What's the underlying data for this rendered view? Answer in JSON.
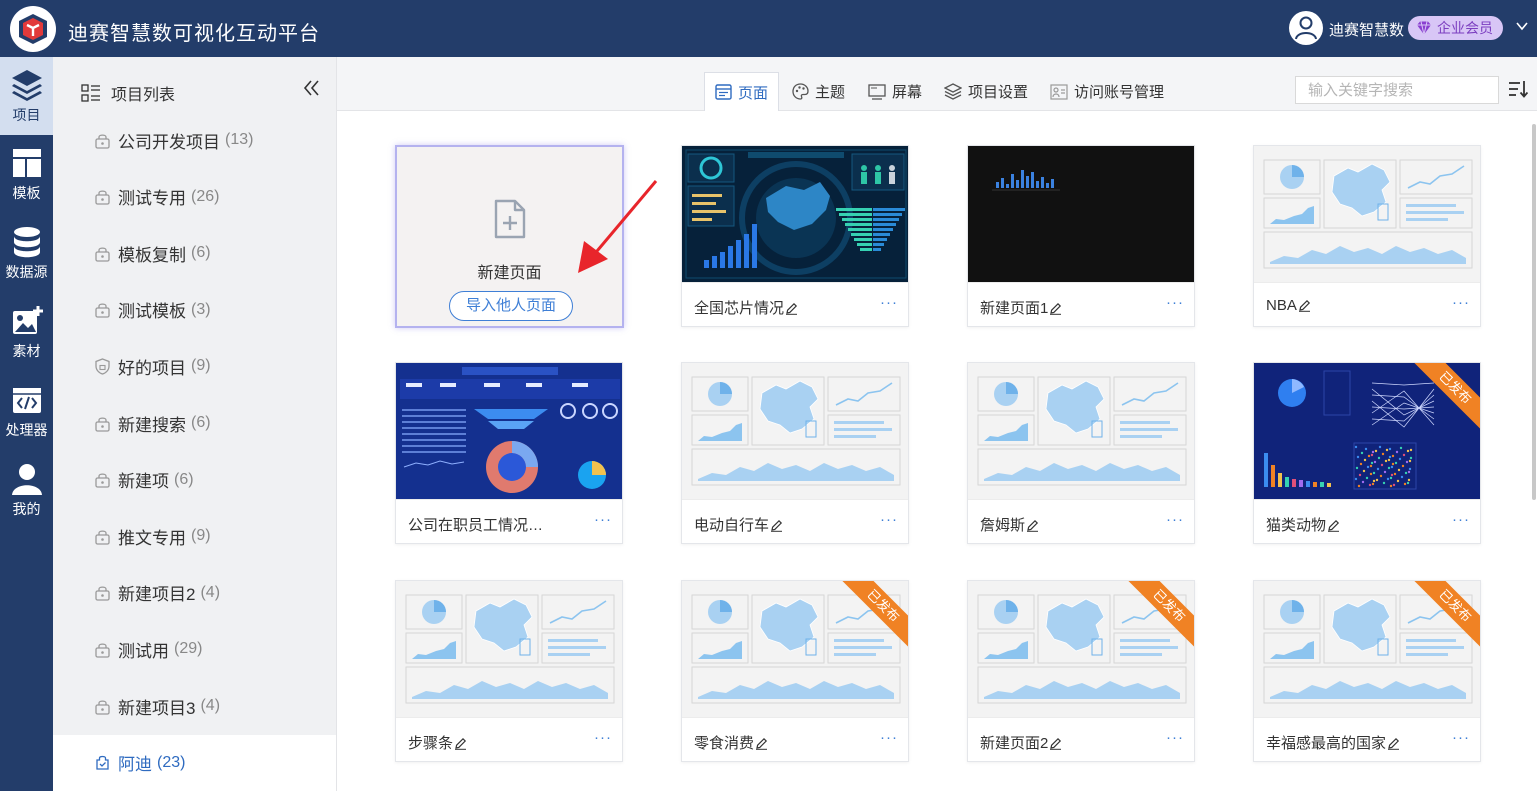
{
  "app": {
    "title": "迪赛智慧数可视化互动平台"
  },
  "user": {
    "name": "迪赛智慧数",
    "badge": "企业会员"
  },
  "nav": [
    {
      "label": "项目",
      "icon": "layers-icon",
      "active": true
    },
    {
      "label": "模板",
      "icon": "template-icon"
    },
    {
      "label": "数据源",
      "icon": "database-icon"
    },
    {
      "label": "素材",
      "icon": "image-add-icon"
    },
    {
      "label": "处理器",
      "icon": "code-icon"
    },
    {
      "label": "我的",
      "icon": "user-icon"
    }
  ],
  "sidebar": {
    "title": "项目列表",
    "items": [
      {
        "name": "公司开发项目",
        "count": "(13)"
      },
      {
        "name": "测试专用",
        "count": "(26)"
      },
      {
        "name": "模板复制",
        "count": "(6)"
      },
      {
        "name": "测试模板",
        "count": "(3)"
      },
      {
        "name": "好的项目",
        "count": "(9)"
      },
      {
        "name": "新建搜索",
        "count": "(6)"
      },
      {
        "name": "新建项",
        "count": "(6)"
      },
      {
        "name": "推文专用",
        "count": "(9)"
      },
      {
        "name": "新建项目2",
        "count": "(4)"
      },
      {
        "name": "测试用",
        "count": "(29)"
      },
      {
        "name": "新建项目3",
        "count": "(4)"
      },
      {
        "name": "阿迪",
        "count": "(23)",
        "active": true
      }
    ]
  },
  "tabs": [
    {
      "label": "页面",
      "icon": "page-icon",
      "active": true
    },
    {
      "label": "主题",
      "icon": "palette-icon"
    },
    {
      "label": "屏幕",
      "icon": "screen-icon"
    },
    {
      "label": "项目设置",
      "icon": "settings-layers-icon"
    },
    {
      "label": "访问账号管理",
      "icon": "account-icon"
    }
  ],
  "search": {
    "placeholder": "输入关键字搜索"
  },
  "new_card": {
    "label": "新建页面",
    "import": "导入他人页面"
  },
  "more_label": "···",
  "published_label": "已发布",
  "cards": [
    {
      "title": "全国芯片情况",
      "thumb": "dashboard-dark"
    },
    {
      "title": "新建页面1",
      "thumb": "black-bars"
    },
    {
      "title": "NBA",
      "thumb": "placeholder"
    },
    {
      "title": "公司在职员工情况的...",
      "thumb": "dashboard-blue"
    },
    {
      "title": "电动自行车",
      "thumb": "placeholder"
    },
    {
      "title": "詹姆斯",
      "thumb": "placeholder"
    },
    {
      "title": "猫类动物",
      "thumb": "dashboard-navy",
      "published": true
    },
    {
      "title": "步骤条",
      "thumb": "placeholder"
    },
    {
      "title": "零食消费",
      "thumb": "placeholder",
      "published": true
    },
    {
      "title": "新建页面2",
      "thumb": "placeholder",
      "published": true
    },
    {
      "title": "幸福感最高的国家",
      "thumb": "placeholder",
      "published": true
    }
  ]
}
